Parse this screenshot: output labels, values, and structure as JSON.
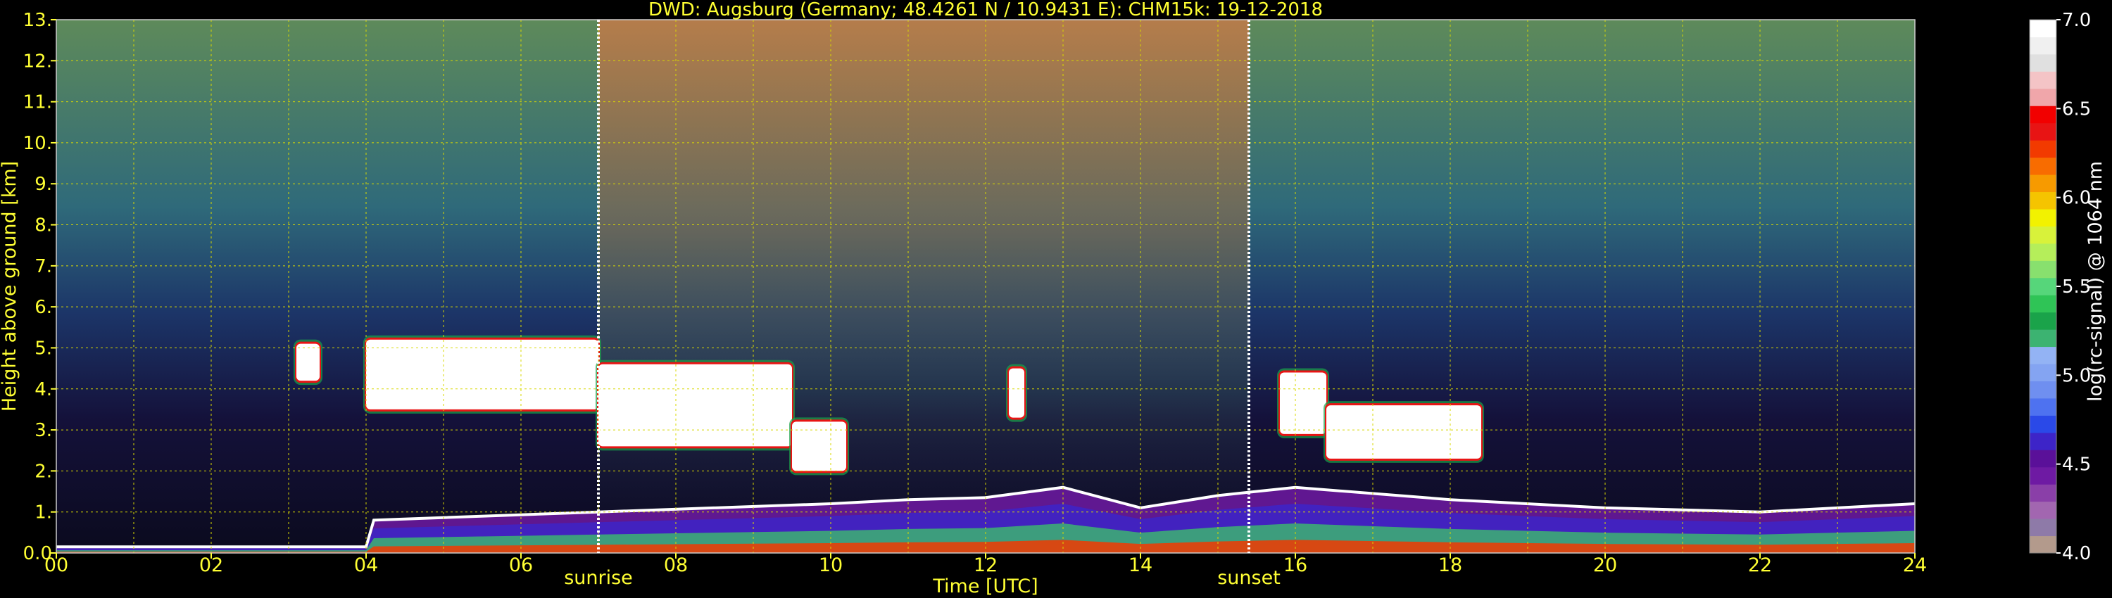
{
  "chart_data": {
    "type": "heatmap",
    "title": "DWD: Augsburg (Germany; 48.4261 N / 10.9431 E):    CHM15k: 19-12-2018",
    "xlabel": "Time [UTC]",
    "ylabel": "Height above ground [km]",
    "xlim": [
      0,
      24
    ],
    "ylim": [
      0,
      13
    ],
    "x_ticks": [
      "00",
      "02",
      "04",
      "06",
      "08",
      "10",
      "12",
      "14",
      "16",
      "18",
      "20",
      "22",
      "24"
    ],
    "y_ticks": [
      "0.0",
      "1.",
      "2.",
      "3.",
      "4.",
      "5.",
      "6.",
      "7.",
      "8.",
      "9.",
      "10.",
      "11.",
      "12.",
      "13."
    ],
    "grid": true,
    "annotations": [
      {
        "label": "sunrise",
        "time": 7.0
      },
      {
        "label": "sunset",
        "time": 15.4
      }
    ],
    "colorbar": {
      "label": "log(rc-signal) @ 1064 nm",
      "range": [
        4.0,
        7.0
      ],
      "ticks": [
        "4.0",
        "4.5",
        "5.0",
        "5.5",
        "6.0",
        "6.5",
        "7.0"
      ],
      "colors": [
        "#b39a8c",
        "#8e7aa8",
        "#a266b0",
        "#8a3fa8",
        "#6e1aa3",
        "#5a1099",
        "#3d24c8",
        "#2a49e8",
        "#4e72f0",
        "#6f8ff0",
        "#84a4f2",
        "#93b3f4",
        "#3cb371",
        "#1aa34a",
        "#2fc456",
        "#56d67a",
        "#88e06e",
        "#b5ee5a",
        "#d8f23a",
        "#f2f200",
        "#f5c400",
        "#f79a00",
        "#f86c00",
        "#f23a00",
        "#e81414",
        "#f20000",
        "#f0a6aa",
        "#f4c4c6",
        "#e0e0e0",
        "#f0f0f0",
        "#ffffff"
      ]
    },
    "cloud_layers": [
      {
        "t0": 3.1,
        "t1": 3.4,
        "h0": 4.2,
        "h1": 5.1
      },
      {
        "t0": 4.0,
        "t1": 7.0,
        "h0": 3.5,
        "h1": 5.2
      },
      {
        "t0": 7.0,
        "t1": 9.5,
        "h0": 2.6,
        "h1": 4.6
      },
      {
        "t0": 9.5,
        "t1": 10.2,
        "h0": 2.0,
        "h1": 3.2
      },
      {
        "t0": 12.3,
        "t1": 12.5,
        "h0": 3.3,
        "h1": 4.5
      },
      {
        "t0": 15.8,
        "t1": 16.4,
        "h0": 2.9,
        "h1": 4.4
      },
      {
        "t0": 16.4,
        "t1": 18.4,
        "h0": 2.3,
        "h1": 3.6
      }
    ],
    "boundary_layer": [
      {
        "t": 0,
        "h": 0.15
      },
      {
        "t": 4,
        "h": 0.15
      },
      {
        "t": 4.1,
        "h": 0.8
      },
      {
        "t": 7,
        "h": 1.0
      },
      {
        "t": 10,
        "h": 1.2
      },
      {
        "t": 11,
        "h": 1.3
      },
      {
        "t": 12,
        "h": 1.35
      },
      {
        "t": 13,
        "h": 1.6
      },
      {
        "t": 14,
        "h": 1.1
      },
      {
        "t": 15,
        "h": 1.4
      },
      {
        "t": 16,
        "h": 1.6
      },
      {
        "t": 18,
        "h": 1.3
      },
      {
        "t": 20,
        "h": 1.1
      },
      {
        "t": 22,
        "h": 1.0
      },
      {
        "t": 24,
        "h": 1.2
      }
    ]
  }
}
